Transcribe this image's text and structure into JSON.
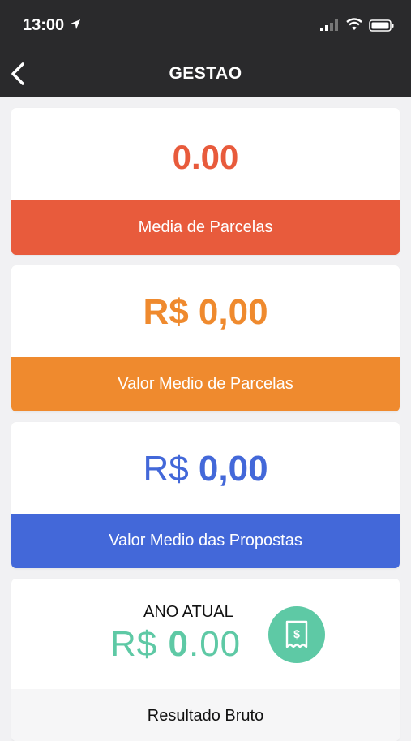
{
  "status_bar": {
    "time": "13:00",
    "icons": [
      "location-arrow-icon",
      "signal-icon",
      "wifi-icon",
      "battery-icon"
    ]
  },
  "nav": {
    "title": "GESTAO",
    "back_icon": "chevron-left-icon"
  },
  "cards": [
    {
      "value": "0.00",
      "label": "Media de Parcelas",
      "color": "#e85b3c"
    },
    {
      "value": "R$ 0,00",
      "label": "Valor Medio de Parcelas",
      "color": "#ef8a2e"
    },
    {
      "value_prefix": "R$",
      "value_amount": "0,00",
      "label": "Valor Medio das Propostas",
      "color": "#4368d9"
    }
  ],
  "summary_card": {
    "period_label": "ANO ATUAL",
    "value_prefix": "R$",
    "value_int": "0",
    "value_dec": ".00",
    "icon": "receipt-dollar-icon",
    "label": "Resultado Bruto",
    "color": "#5ec9a5"
  }
}
